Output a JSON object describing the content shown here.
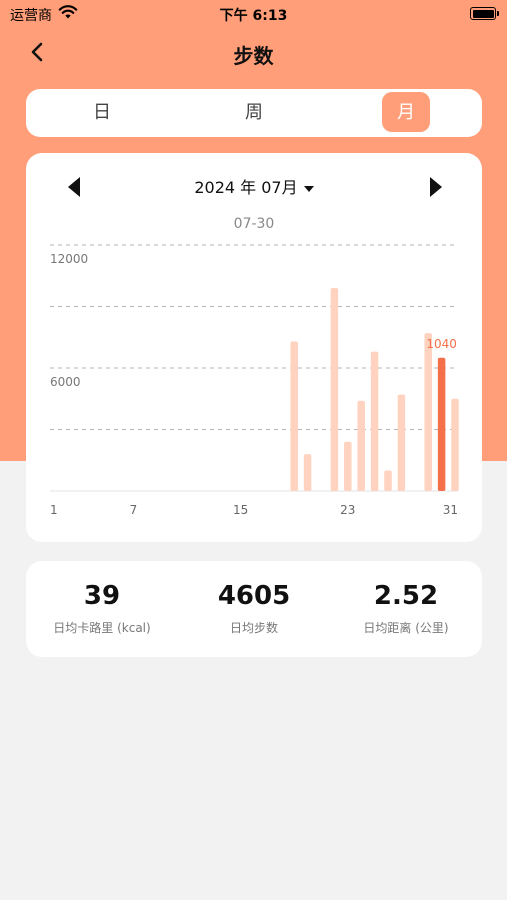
{
  "status_bar": {
    "carrier": "运营商",
    "time": "下午 6:13"
  },
  "nav": {
    "title": "步数",
    "back_icon": "chevron-left-icon"
  },
  "tabs": [
    {
      "label": "日",
      "active": false
    },
    {
      "label": "周",
      "active": false
    },
    {
      "label": "月",
      "active": true
    }
  ],
  "chart_header": {
    "month": "2024 年 07月",
    "selected_date": "07-30"
  },
  "colors": {
    "accent": "#ff9e78",
    "bar": "#ffd3bf",
    "bar_selected": "#f4704a"
  },
  "chart_data": {
    "type": "bar",
    "x": [
      1,
      2,
      3,
      4,
      5,
      6,
      7,
      8,
      9,
      10,
      11,
      12,
      13,
      14,
      15,
      16,
      17,
      18,
      19,
      20,
      21,
      22,
      23,
      24,
      25,
      26,
      27,
      28,
      29,
      30,
      31
    ],
    "values": [
      0,
      0,
      0,
      0,
      0,
      0,
      0,
      0,
      0,
      0,
      0,
      0,
      0,
      0,
      0,
      0,
      0,
      0,
      7300,
      1800,
      0,
      9900,
      2400,
      4400,
      6800,
      1000,
      4700,
      0,
      7700,
      6500,
      4500,
      1040,
      0
    ],
    "x_ticks": [
      "1",
      "7",
      "15",
      "23",
      "31"
    ],
    "y_ticks": [
      "6000",
      "12000"
    ],
    "ylim": [
      0,
      12000
    ],
    "selected_day": 30,
    "selected_label": "1040",
    "grid": true
  },
  "stats": [
    {
      "value": "39",
      "label": "日均卡路里 (kcal)"
    },
    {
      "value": "4605",
      "label": "日均步数"
    },
    {
      "value": "2.52",
      "label": "日均距离 (公里)"
    }
  ]
}
